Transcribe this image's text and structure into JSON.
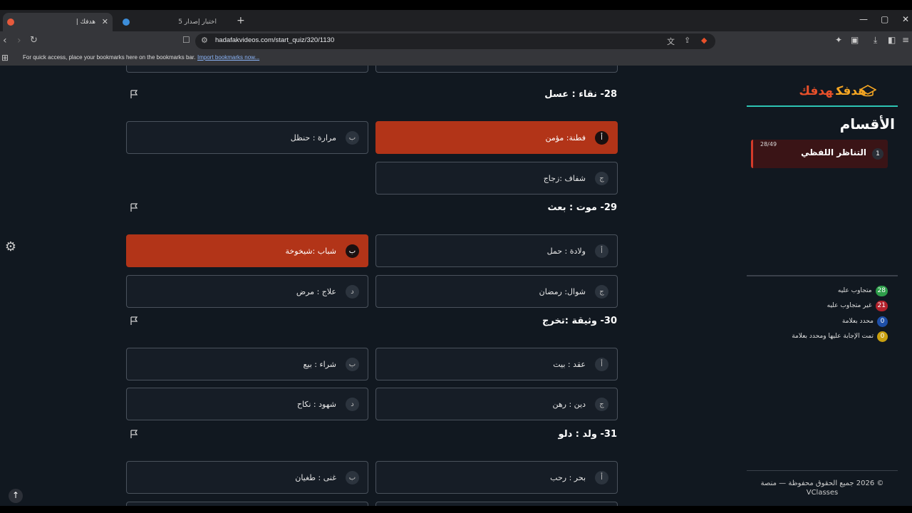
{
  "browser": {
    "tabs": [
      {
        "title": "هدفك |",
        "active": true
      },
      {
        "title": "اختبار إصدار 5",
        "active": false
      }
    ],
    "url": "hadafakvideos.com/start_quiz/320/1130",
    "bookmarks_text": "For quick access, place your bookmarks here on the bookmarks bar.",
    "bookmarks_link": "Import bookmarks now..."
  },
  "questions": [
    {
      "title": "28- نقاء : عسل",
      "options": [
        {
          "letter": "أ",
          "text": "فطنة: مؤمن",
          "selected": true
        },
        {
          "letter": "ب",
          "text": "مرارة : حنظل",
          "selected": false
        },
        {
          "letter": "ج",
          "text": "شفاف :زجاج",
          "selected": false
        }
      ]
    },
    {
      "title": "29- موت : بعث",
      "options": [
        {
          "letter": "أ",
          "text": "ولادة : حمل",
          "selected": false
        },
        {
          "letter": "ب",
          "text": "شباب :شيخوخة",
          "selected": true
        },
        {
          "letter": "ج",
          "text": "شوال: رمضان",
          "selected": false
        },
        {
          "letter": "د",
          "text": "علاج : مرض",
          "selected": false
        }
      ]
    },
    {
      "title": "30- وثيقة :تخرج",
      "options": [
        {
          "letter": "أ",
          "text": "عقد : بيت",
          "selected": false
        },
        {
          "letter": "ب",
          "text": "شراء : بيع",
          "selected": false
        },
        {
          "letter": "ج",
          "text": "دين : رهن",
          "selected": false
        },
        {
          "letter": "د",
          "text": "شهود : نكاح",
          "selected": false
        }
      ]
    },
    {
      "title": "31- ولد : دلو",
      "options": [
        {
          "letter": "أ",
          "text": "بحر : رحب",
          "selected": false
        },
        {
          "letter": "ب",
          "text": "غنى : طغيان",
          "selected": false
        }
      ]
    }
  ],
  "sidebar": {
    "logo_main": "هدفك",
    "logo_accent": "هدفك",
    "sections_title": "الأقسام",
    "section": {
      "number": "1",
      "name": "التناظر اللفظي",
      "count": "28/49"
    },
    "legend": [
      {
        "count": "28",
        "label": "متجاوب عليه",
        "color": "#2e9e4a"
      },
      {
        "count": "21",
        "label": "غير متجاوب عليه",
        "color": "#b3222c"
      },
      {
        "count": "0",
        "label": "محدد بعلامة",
        "color": "#1e4fa8"
      },
      {
        "count": "0",
        "label": "تمت الإجابة عليها ومحدد بعلامة",
        "color": "#c9a010"
      }
    ],
    "footer": "© 2026 جميع الحقوق محفوظة — منصة VClasses"
  }
}
